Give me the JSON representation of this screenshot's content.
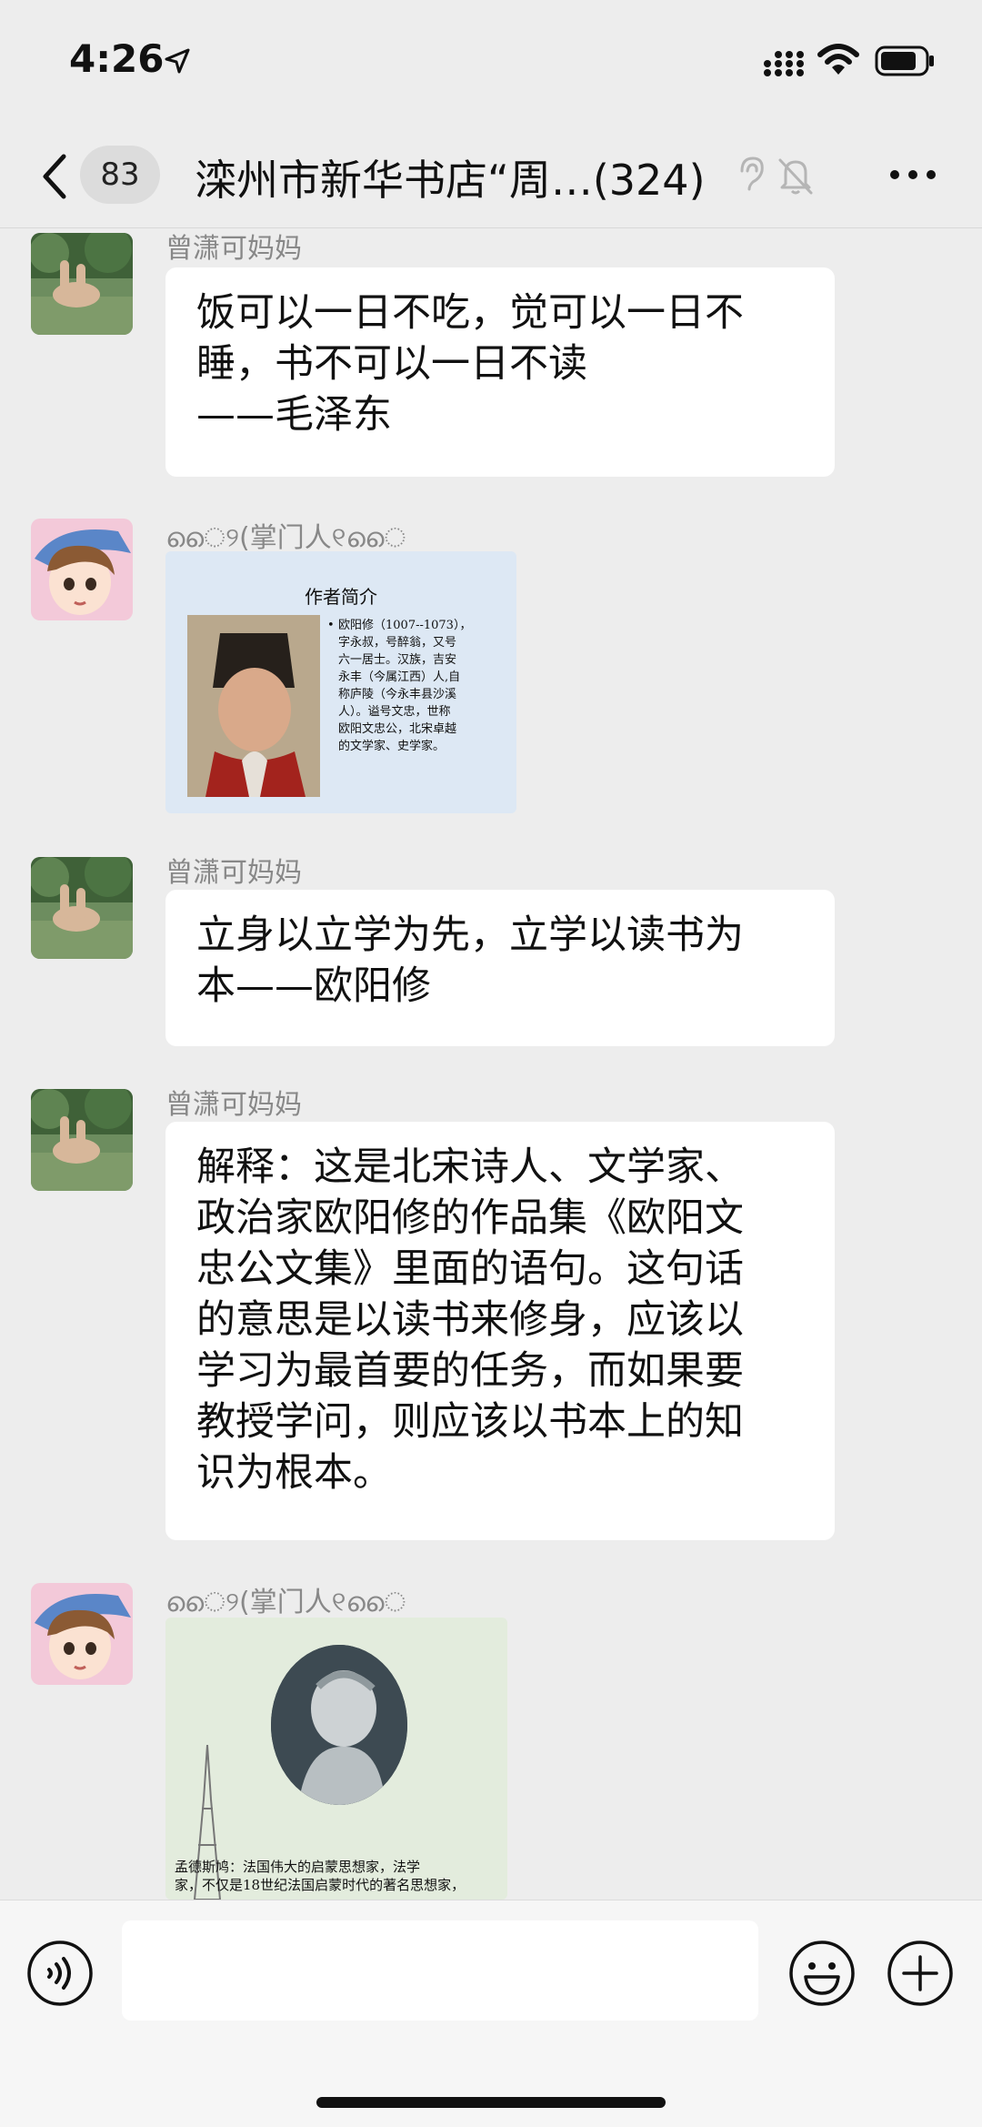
{
  "status_bar": {
    "time": "4:26"
  },
  "nav": {
    "unread_count": "83",
    "title": "滦州市新华书店“周…(324)"
  },
  "messages": [
    {
      "sender": "曾潇可妈妈",
      "type": "text",
      "text": "饭可以一日不吃，觉可以一日不\n睡，书不可以一日不读\n——毛泽东"
    },
    {
      "sender": "ൈ୨(掌门人୧ൈ",
      "type": "image",
      "image": {
        "title": "作者简介",
        "bullet": "欧阳修（1007--1073），\n字永叔，号醉翁，又号\n六一居士。汉族，吉安\n永丰（今属江西）人,自\n称庐陵（今永丰县沙溪\n人）。谥号文忠，世称\n欧阳文忠公，北宋卓越\n的文学家、史学家。"
      }
    },
    {
      "sender": "曾潇可妈妈",
      "type": "text",
      "text": "立身以立学为先，立学以读书为\n本——欧阳修"
    },
    {
      "sender": "曾潇可妈妈",
      "type": "text",
      "text": "解释：这是北宋诗人、文学家、\n政治家欧阳修的作品集《欧阳文\n忠公文集》里面的语句。这句话\n的意思是以读书来修身，应该以\n学习为最首要的任务，而如果要\n教授学问，则应该以书本上的知\n识为根本。"
    },
    {
      "sender": "ൈ୨(掌门人୧ൈ",
      "type": "image",
      "image": {
        "caption": "孟德斯鸠：法国伟大的启蒙思想家，法学\n家，不仅是18世纪法国启蒙时代的著名思想家，"
      }
    }
  ],
  "input_bar": {
    "placeholder": ""
  },
  "colors": {
    "background": "#ededed",
    "bubble": "#ffffff",
    "sender": "#888888"
  }
}
